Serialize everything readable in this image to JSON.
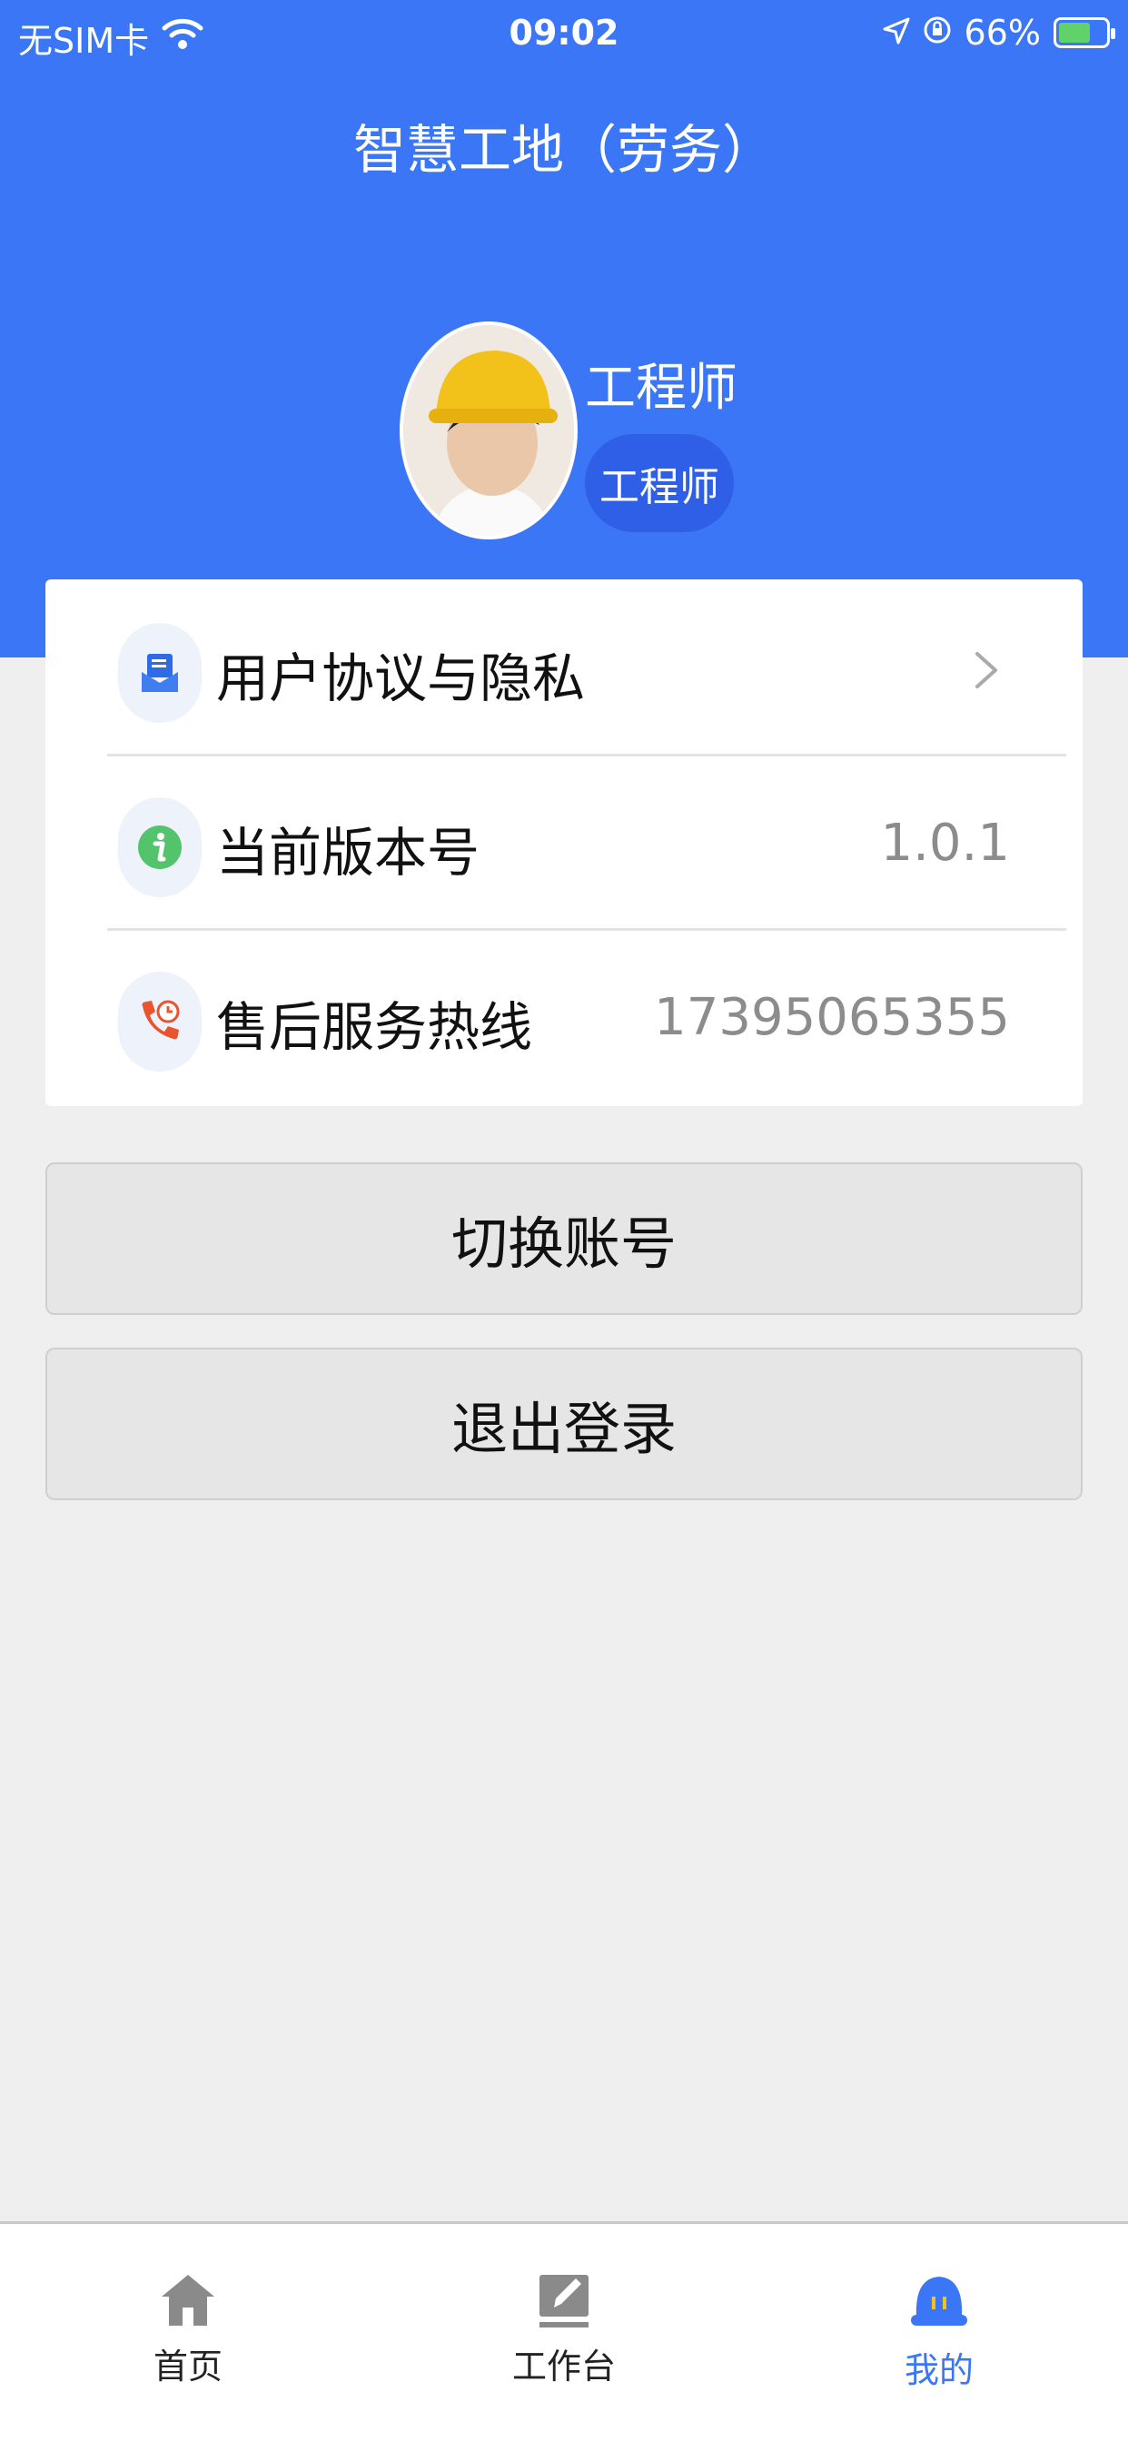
{
  "status_bar": {
    "carrier": "无SIM卡",
    "time": "09:02",
    "battery": "66%"
  },
  "header": {
    "title": "智慧工地（劳务）"
  },
  "profile": {
    "name": "工程师",
    "role": "工程师"
  },
  "menu": {
    "items": [
      {
        "label": "用户协议与隐私",
        "value": "",
        "icon": "document-icon"
      },
      {
        "label": "当前版本号",
        "value": "1.0.1",
        "icon": "info-icon"
      },
      {
        "label": "售后服务热线",
        "value": "17395065355",
        "icon": "phone-clock-icon"
      }
    ]
  },
  "actions": {
    "switch_account": "切换账号",
    "logout": "退出登录"
  },
  "tabbar": {
    "tabs": [
      {
        "label": "首页",
        "icon": "home-icon"
      },
      {
        "label": "工作台",
        "icon": "edit-icon"
      },
      {
        "label": "我的",
        "icon": "helmet-icon"
      }
    ],
    "active_color": "#3a76f5"
  },
  "colors": {
    "primary": "#3a76f5",
    "background": "#efefef"
  }
}
